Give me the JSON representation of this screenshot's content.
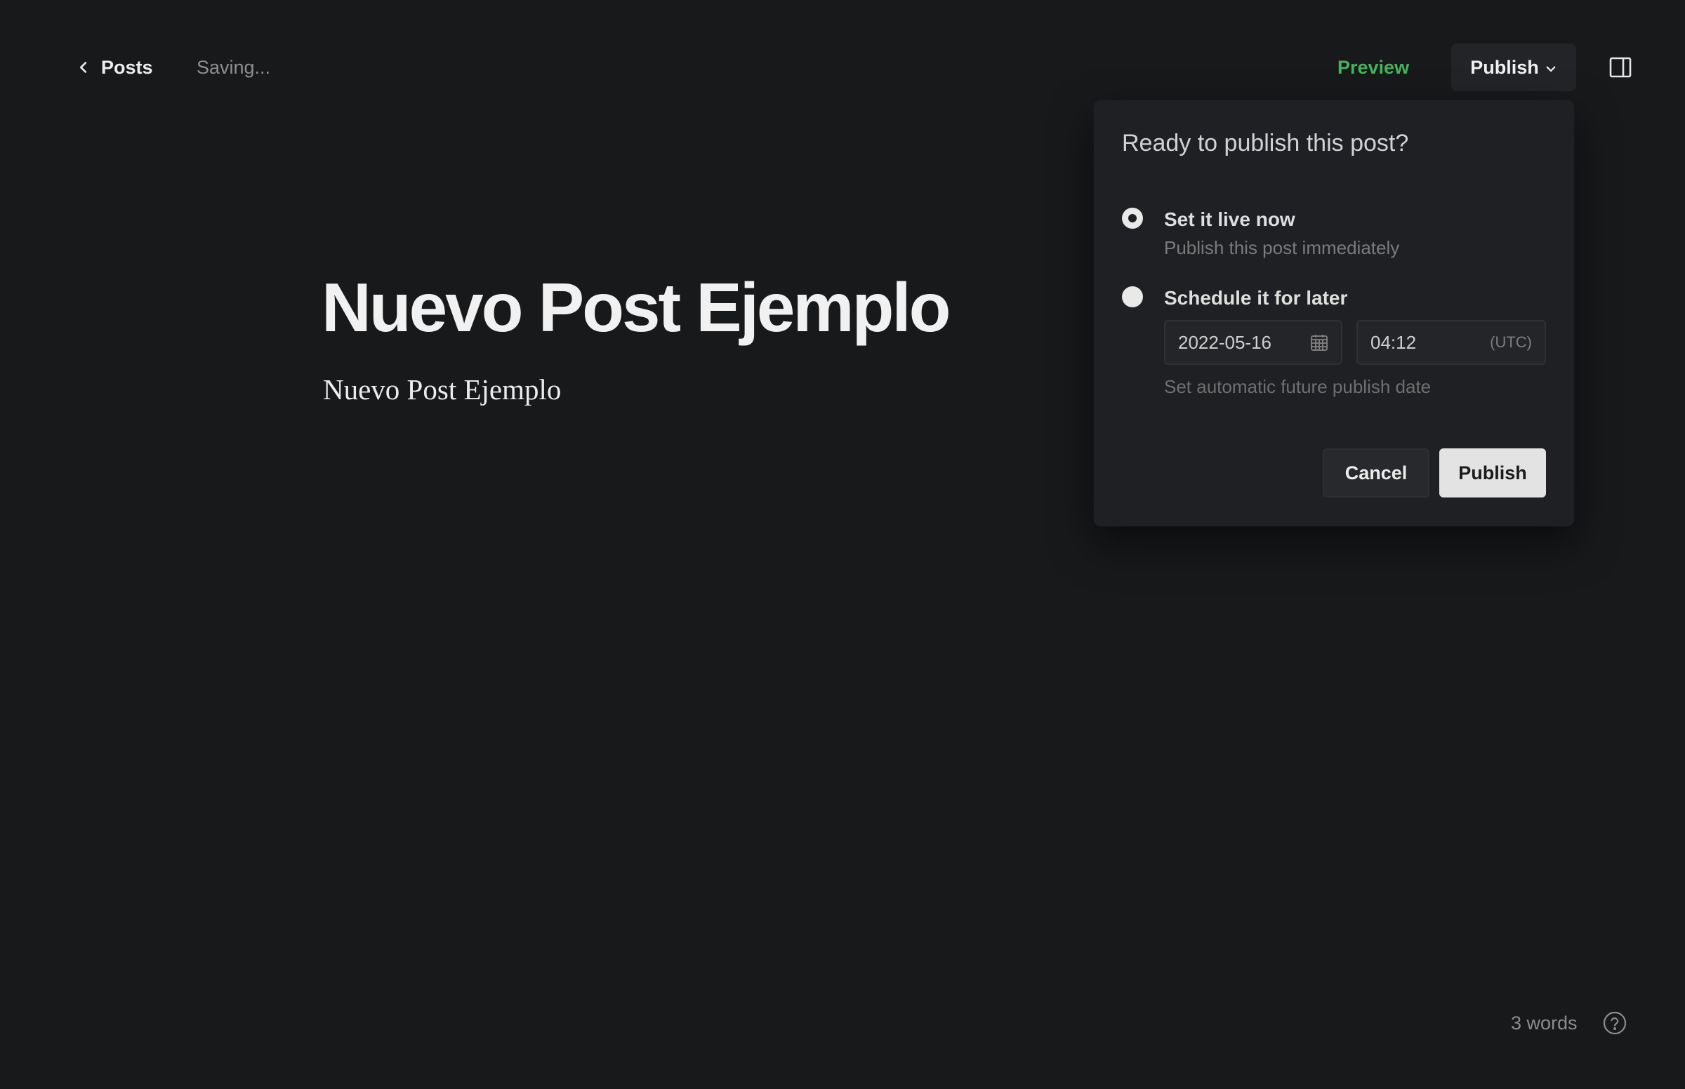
{
  "topbar": {
    "back_label": "Posts",
    "status": "Saving...",
    "preview_label": "Preview",
    "publish_label": "Publish"
  },
  "editor": {
    "title": "Nuevo Post Ejemplo",
    "body": "Nuevo Post Ejemplo"
  },
  "publish_popover": {
    "heading": "Ready to publish this post?",
    "options": [
      {
        "label": "Set it live now",
        "description": "Publish this post immediately",
        "selected": true
      },
      {
        "label": "Schedule it for later",
        "description": "",
        "selected": false
      }
    ],
    "date_value": "2022-05-16",
    "time_value": "04:12",
    "timezone": "(UTC)",
    "schedule_note": "Set automatic future publish date",
    "cancel_label": "Cancel",
    "confirm_label": "Publish"
  },
  "footer": {
    "word_count": "3 words"
  },
  "colors": {
    "background": "#18191b",
    "accent_green": "#46b35a",
    "popover_bg": "#1f2023",
    "primary_button": "#e3e3e3"
  },
  "icons": [
    "chevron-left-icon",
    "chevron-down-icon",
    "sidebar-panel-icon",
    "calendar-icon",
    "help-circle-icon"
  ]
}
